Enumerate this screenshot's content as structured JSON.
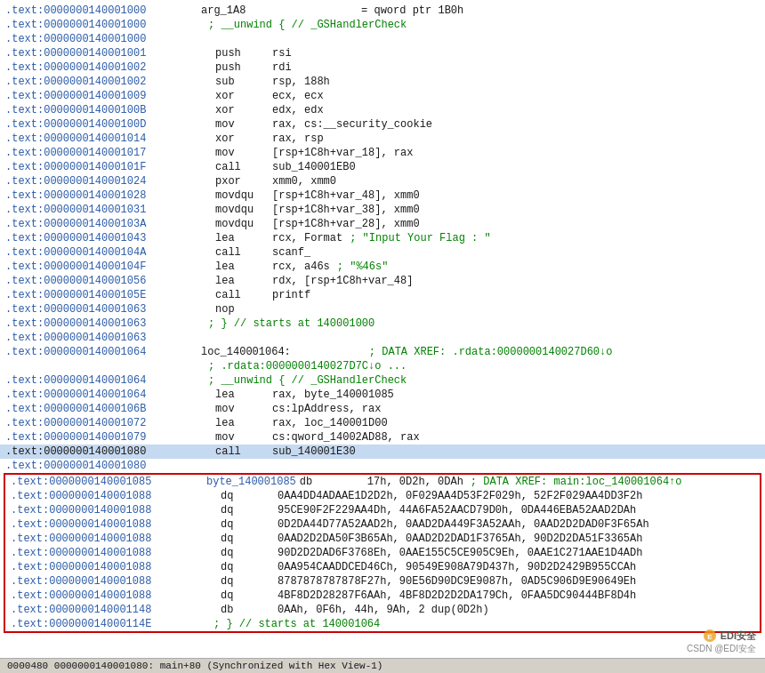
{
  "title": "IDA Pro disassembly view",
  "lines": [
    {
      "addr": ".text:0000000140001000",
      "content": "arg_1A8",
      "mnemonic": "",
      "operand": "= qword ptr 1B0h",
      "comment": "",
      "highlight": false,
      "type": "normal"
    },
    {
      "addr": ".text:0000000140001000",
      "content": "",
      "mnemonic": "",
      "operand": "; __unwind { // _GSHandlerCheck",
      "comment": "",
      "highlight": false,
      "type": "comment-line"
    },
    {
      "addr": ".text:0000000140001000",
      "content": "",
      "mnemonic": "",
      "operand": "",
      "comment": "",
      "highlight": false,
      "type": "empty"
    },
    {
      "addr": ".text:0000000140001001",
      "content": "",
      "mnemonic": "push",
      "operand": "rsi",
      "comment": "",
      "highlight": false,
      "type": "instr"
    },
    {
      "addr": ".text:0000000140001002",
      "content": "",
      "mnemonic": "push",
      "operand": "rdi",
      "comment": "",
      "highlight": false,
      "type": "instr"
    },
    {
      "addr": ".text:0000000140001002",
      "content": "",
      "mnemonic": "sub",
      "operand": "rsp, 188h",
      "comment": "",
      "highlight": false,
      "type": "instr"
    },
    {
      "addr": ".text:0000000140001009",
      "content": "",
      "mnemonic": "xor",
      "operand": "ecx, ecx",
      "comment": "",
      "highlight": false,
      "type": "instr"
    },
    {
      "addr": ".text:000000014000100B",
      "content": "",
      "mnemonic": "xor",
      "operand": "edx, edx",
      "comment": "",
      "highlight": false,
      "type": "instr"
    },
    {
      "addr": ".text:000000014000100D",
      "content": "",
      "mnemonic": "mov",
      "operand": "rax, cs:__security_cookie",
      "comment": "",
      "highlight": false,
      "type": "instr"
    },
    {
      "addr": ".text:0000000140001014",
      "content": "",
      "mnemonic": "xor",
      "operand": "rax, rsp",
      "comment": "",
      "highlight": false,
      "type": "instr"
    },
    {
      "addr": ".text:0000000140001017",
      "content": "",
      "mnemonic": "mov",
      "operand": "[rsp+1C8h+var_18], rax",
      "comment": "",
      "highlight": false,
      "type": "instr"
    },
    {
      "addr": ".text:000000014000101F",
      "content": "",
      "mnemonic": "call",
      "operand": "sub_140001EB0",
      "comment": "",
      "highlight": false,
      "type": "instr"
    },
    {
      "addr": ".text:0000000140001024",
      "content": "",
      "mnemonic": "pxor",
      "operand": "xmm0, xmm0",
      "comment": "",
      "highlight": false,
      "type": "instr"
    },
    {
      "addr": ".text:0000000140001028",
      "content": "",
      "mnemonic": "movdqu",
      "operand": "[rsp+1C8h+var_48], xmm0",
      "comment": "",
      "highlight": false,
      "type": "instr"
    },
    {
      "addr": ".text:0000000140001031",
      "content": "",
      "mnemonic": "movdqu",
      "operand": "[rsp+1C8h+var_38], xmm0",
      "comment": "",
      "highlight": false,
      "type": "instr"
    },
    {
      "addr": ".text:000000014000103A",
      "content": "",
      "mnemonic": "movdqu",
      "operand": "[rsp+1C8h+var_28], xmm0",
      "comment": "",
      "highlight": false,
      "type": "instr"
    },
    {
      "addr": ".text:0000000140001043",
      "content": "",
      "mnemonic": "lea",
      "operand": "rcx, Format",
      "comment": "; \"Input Your Flag : \"",
      "highlight": false,
      "type": "instr"
    },
    {
      "addr": ".text:000000014000104A",
      "content": "",
      "mnemonic": "call",
      "operand": "scanf_",
      "comment": "",
      "highlight": false,
      "type": "instr"
    },
    {
      "addr": ".text:000000014000104F",
      "content": "",
      "mnemonic": "lea",
      "operand": "rcx, a46s",
      "comment": "; \"%46s\"",
      "highlight": false,
      "type": "instr"
    },
    {
      "addr": ".text:0000000140001056",
      "content": "",
      "mnemonic": "lea",
      "operand": "rdx, [rsp+1C8h+var_48]",
      "comment": "",
      "highlight": false,
      "type": "instr"
    },
    {
      "addr": ".text:000000014000105E",
      "content": "",
      "mnemonic": "call",
      "operand": "printf",
      "comment": "",
      "highlight": false,
      "type": "instr"
    },
    {
      "addr": ".text:0000000140001063",
      "content": "",
      "mnemonic": "nop",
      "operand": "",
      "comment": "",
      "highlight": false,
      "type": "instr"
    },
    {
      "addr": ".text:0000000140001063",
      "content": "",
      "mnemonic": "",
      "operand": "; } // starts at 140001000",
      "comment": "",
      "highlight": false,
      "type": "comment-line"
    },
    {
      "addr": ".text:0000000140001063",
      "content": "",
      "mnemonic": "",
      "operand": "",
      "comment": "",
      "highlight": false,
      "type": "empty"
    },
    {
      "addr": ".text:0000000140001064",
      "content": "loc_140001064:",
      "mnemonic": "",
      "operand": "",
      "comment": "; DATA XREF: .rdata:0000000140027D60↓o",
      "highlight": false,
      "type": "label"
    },
    {
      "addr": "",
      "content": "",
      "mnemonic": "",
      "operand": "",
      "comment": "; .rdata:0000000140027D7C↓o ...",
      "highlight": false,
      "type": "comment-only"
    },
    {
      "addr": ".text:0000000140001064",
      "content": "",
      "mnemonic": "",
      "operand": "; __unwind { // _GSHandlerCheck",
      "comment": "",
      "highlight": false,
      "type": "comment-line"
    },
    {
      "addr": ".text:0000000140001064",
      "content": "",
      "mnemonic": "lea",
      "operand": "rax, byte_140001085",
      "comment": "",
      "highlight": false,
      "type": "instr"
    },
    {
      "addr": ".text:000000014000106B",
      "content": "",
      "mnemonic": "mov",
      "operand": "cs:lpAddress, rax",
      "comment": "",
      "highlight": false,
      "type": "instr"
    },
    {
      "addr": ".text:0000000140001072",
      "content": "",
      "mnemonic": "lea",
      "operand": "rax, loc_140001D00",
      "comment": "",
      "highlight": false,
      "type": "instr"
    },
    {
      "addr": ".text:0000000140001079",
      "content": "",
      "mnemonic": "mov",
      "operand": "cs:qword_14002AD88, rax",
      "comment": "",
      "highlight": false,
      "type": "instr"
    },
    {
      "addr": ".text:0000000140001080",
      "content": "",
      "mnemonic": "call",
      "operand": "sub_140001E30",
      "comment": "",
      "highlight": true,
      "type": "instr"
    },
    {
      "addr": ".text:0000000140001080",
      "content": "",
      "mnemonic": "",
      "operand": "",
      "comment": "",
      "highlight": false,
      "type": "empty"
    }
  ],
  "red_box_lines": [
    {
      "addr": ".text:0000000140001085",
      "label": "byte_140001085",
      "mnemonic": "db",
      "operand": "17h, 0D2h, 0DAh",
      "comment": "; DATA XREF: main:loc_140001064↑o"
    },
    {
      "addr": ".text:0000000140001088",
      "label": "",
      "mnemonic": "dq",
      "operand": "0AA4DD4ADAAE1D2D2h, 0F029AA4D53F2F029h, 52F2F029AA4DD3F2h",
      "comment": ""
    },
    {
      "addr": ".text:0000000140001088",
      "label": "",
      "mnemonic": "dq",
      "operand": "95CE90F2F229AA4Dh, 44A6FA52AACD79D0h, 0DA446EBA52AAD2DAh",
      "comment": ""
    },
    {
      "addr": ".text:0000000140001088",
      "label": "",
      "mnemonic": "dq",
      "operand": "0D2DA44D77A52AAD2h, 0AAD2DA449F3A52AAh, 0AAD2D2DAD0F3F65Ah",
      "comment": ""
    },
    {
      "addr": ".text:0000000140001088",
      "label": "",
      "mnemonic": "dq",
      "operand": "0AAD2D2DA50F3B65Ah, 0AAD2D2DAD1F3765Ah, 90D2D2DA51F3365Ah",
      "comment": ""
    },
    {
      "addr": ".text:0000000140001088",
      "label": "",
      "mnemonic": "dq",
      "operand": "90D2D2DAD6F3768Eh, 0AAE155C5CE905C9Eh, 0AAE1C271AAE1D4ADh",
      "comment": ""
    },
    {
      "addr": ".text:0000000140001088",
      "label": "",
      "mnemonic": "dq",
      "operand": "0AA954CAADDCED46Ch, 90549E908A79D437h, 90D2D2429B955CCAh",
      "comment": ""
    },
    {
      "addr": ".text:0000000140001088",
      "label": "",
      "mnemonic": "dq",
      "operand": "8787878787878F27h, 90E56D90DC9E9087h, 0AD5C906D9E90649Eh",
      "comment": ""
    },
    {
      "addr": ".text:0000000140001088",
      "label": "",
      "mnemonic": "dq",
      "operand": "4BF8D2D28287F6AAh, 4BF8D2D2D2DA179Ch, 0FAA5DC90444BF8D4h",
      "comment": ""
    },
    {
      "addr": ".text:0000000140001148",
      "label": "",
      "mnemonic": "db",
      "operand": "0AAh, 0F6h, 44h, 9Ah, 2 dup(0D2h)",
      "comment": ""
    },
    {
      "addr": ".text:000000014000114E",
      "label": "",
      "mnemonic": "",
      "operand": "; } // starts at 140001064",
      "comment": "",
      "type": "comment"
    }
  ],
  "status_bar": "0000480 0000000140001080: main+80 (Synchronized with Hex View-1)",
  "watermark_line1": "EDI安全",
  "watermark_line2": "CSDN @EDI安全"
}
